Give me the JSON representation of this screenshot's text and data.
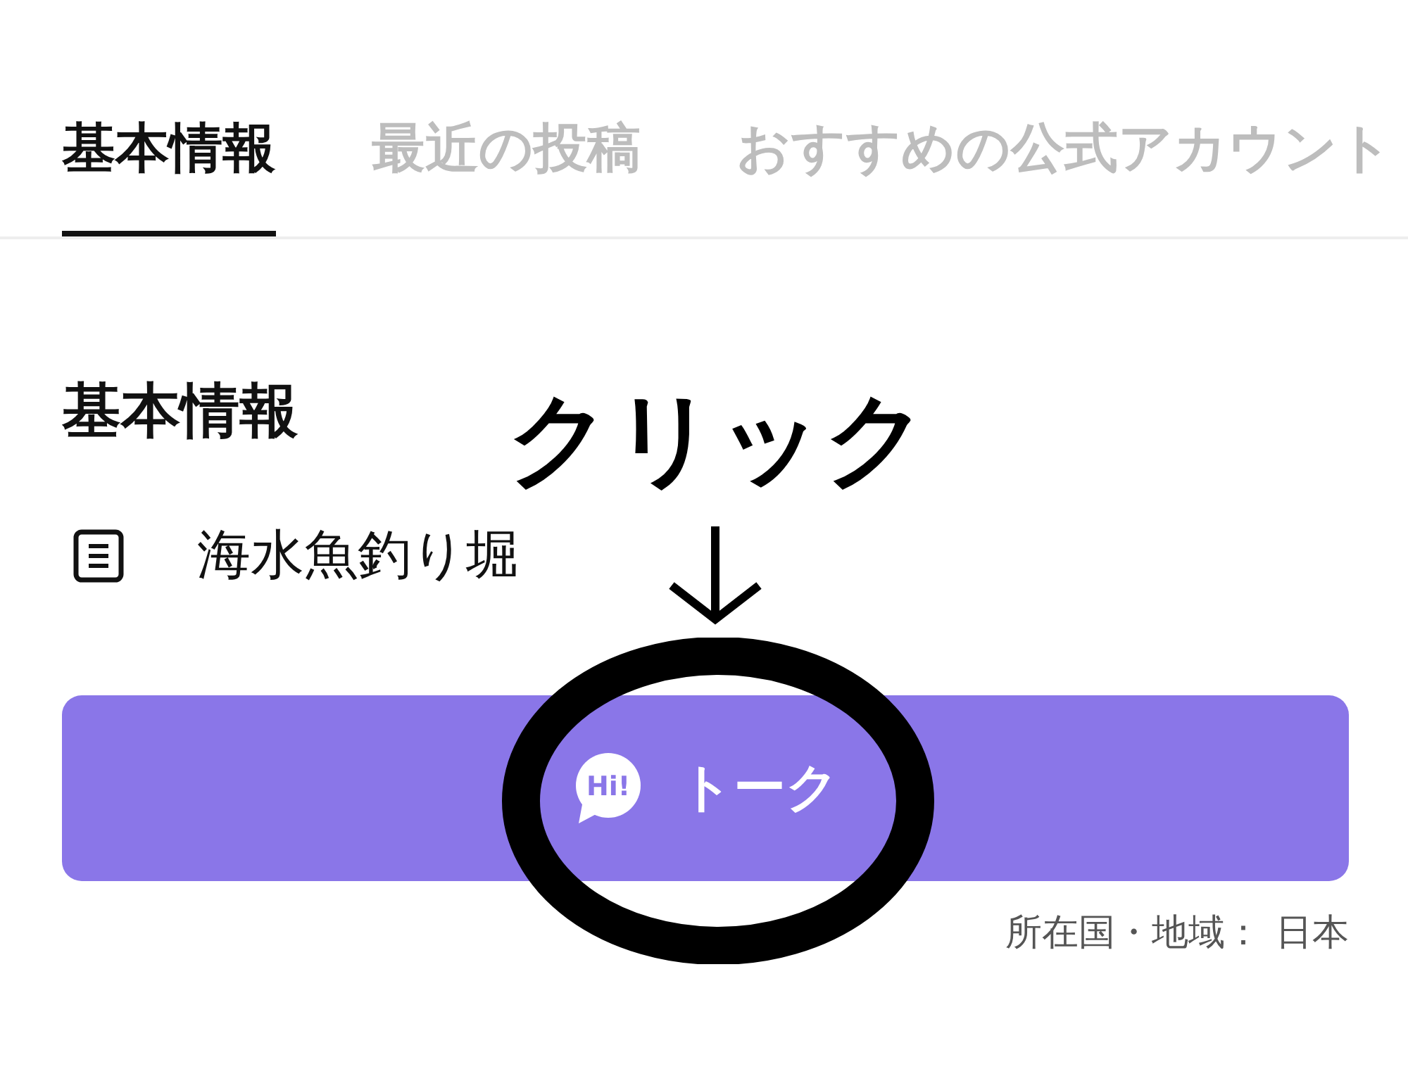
{
  "tabs": [
    {
      "label": "基本情報",
      "selected": true
    },
    {
      "label": "最近の投稿",
      "selected": false
    },
    {
      "label": "おすすめの公式アカウント",
      "selected": false
    }
  ],
  "section": {
    "title": "基本情報",
    "items": [
      {
        "kind": "description",
        "text": "海水魚釣り堀"
      }
    ]
  },
  "talk_button": {
    "icon_text": "Hi!",
    "label": "トーク"
  },
  "location": {
    "label": "所在国・地域：",
    "value": "日本"
  },
  "annotation": {
    "label": "クリック"
  }
}
